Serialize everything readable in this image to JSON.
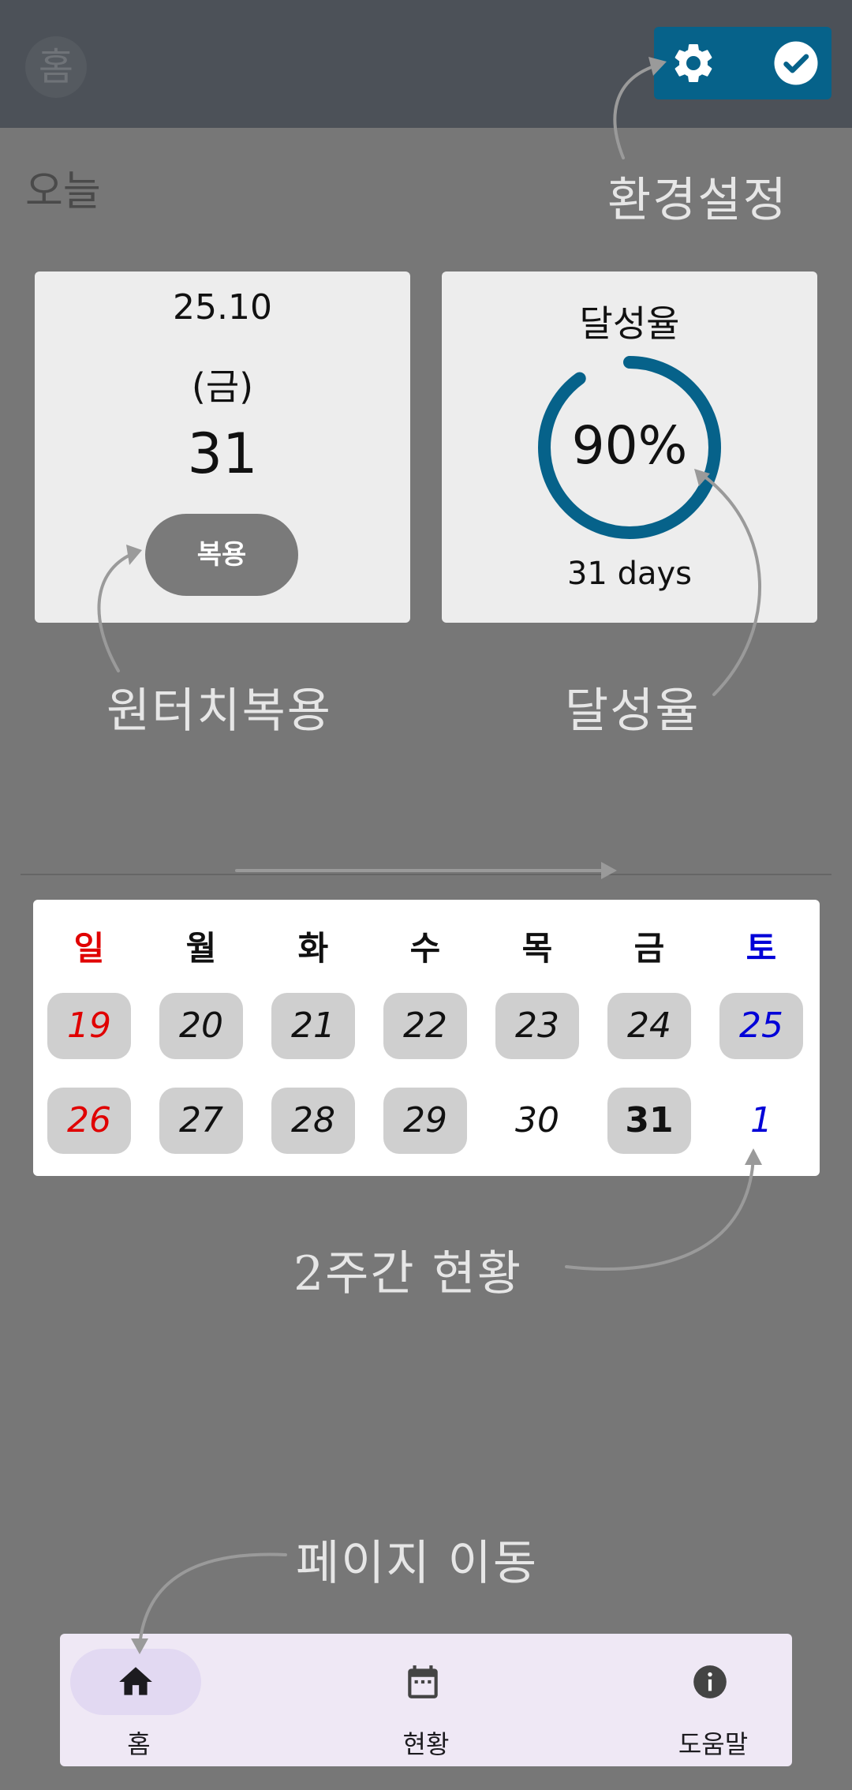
{
  "appbar": {
    "title": "홈",
    "icons": [
      "gear-icon",
      "check-circle-icon"
    ],
    "accent": "#06628a"
  },
  "today_label": "오늘",
  "date_card": {
    "year_month": "25.10",
    "weekday": "(금)",
    "day": "31",
    "take_button": "복용"
  },
  "rate_card": {
    "title": "달성율",
    "value": "90%",
    "progress": 0.9,
    "days": "31 days"
  },
  "annotations": {
    "settings": "환경설정",
    "one_touch": "원터치복용",
    "rate": "달성율",
    "two_weeks": "2주간 현황",
    "page_move": "페이지 이동"
  },
  "calendar": {
    "weekdays": [
      "일",
      "월",
      "화",
      "수",
      "목",
      "금",
      "토"
    ],
    "weeks": [
      [
        {
          "day": "19",
          "filled": true
        },
        {
          "day": "20",
          "filled": true
        },
        {
          "day": "21",
          "filled": true
        },
        {
          "day": "22",
          "filled": true
        },
        {
          "day": "23",
          "filled": true
        },
        {
          "day": "24",
          "filled": true
        },
        {
          "day": "25",
          "filled": true
        }
      ],
      [
        {
          "day": "26",
          "filled": true
        },
        {
          "day": "27",
          "filled": true
        },
        {
          "day": "28",
          "filled": true
        },
        {
          "day": "29",
          "filled": true
        },
        {
          "day": "30",
          "filled": false
        },
        {
          "day": "31",
          "filled": true,
          "today": true
        },
        {
          "day": "1",
          "filled": false
        }
      ]
    ],
    "sunday_color": "#e00000",
    "saturday_color": "#0000d8"
  },
  "bottom_nav": {
    "items": [
      {
        "label": "홈",
        "icon": "home-icon",
        "selected": true
      },
      {
        "label": "현황",
        "icon": "calendar-icon",
        "selected": false
      },
      {
        "label": "도움말",
        "icon": "info-icon",
        "selected": false
      }
    ]
  }
}
